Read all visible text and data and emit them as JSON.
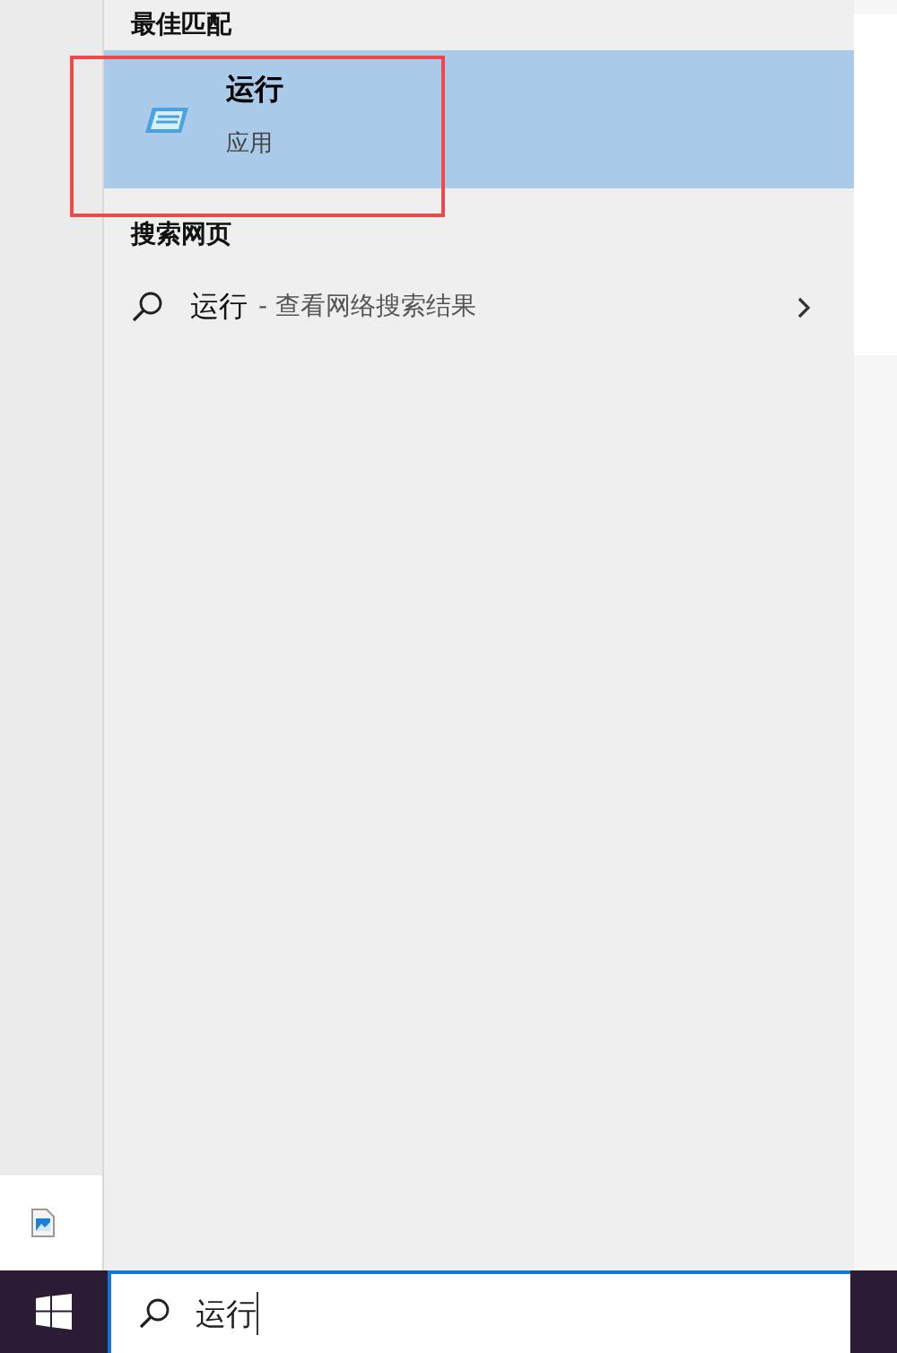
{
  "best_match": {
    "heading": "最佳匹配",
    "item": {
      "title": "运行",
      "subtitle": "应用",
      "selected": true
    }
  },
  "web_search": {
    "heading": "搜索网页",
    "item": {
      "query": "运行",
      "suffix": "- 查看网络搜索结果"
    }
  },
  "taskbar": {
    "search": {
      "value": "运行"
    }
  }
}
